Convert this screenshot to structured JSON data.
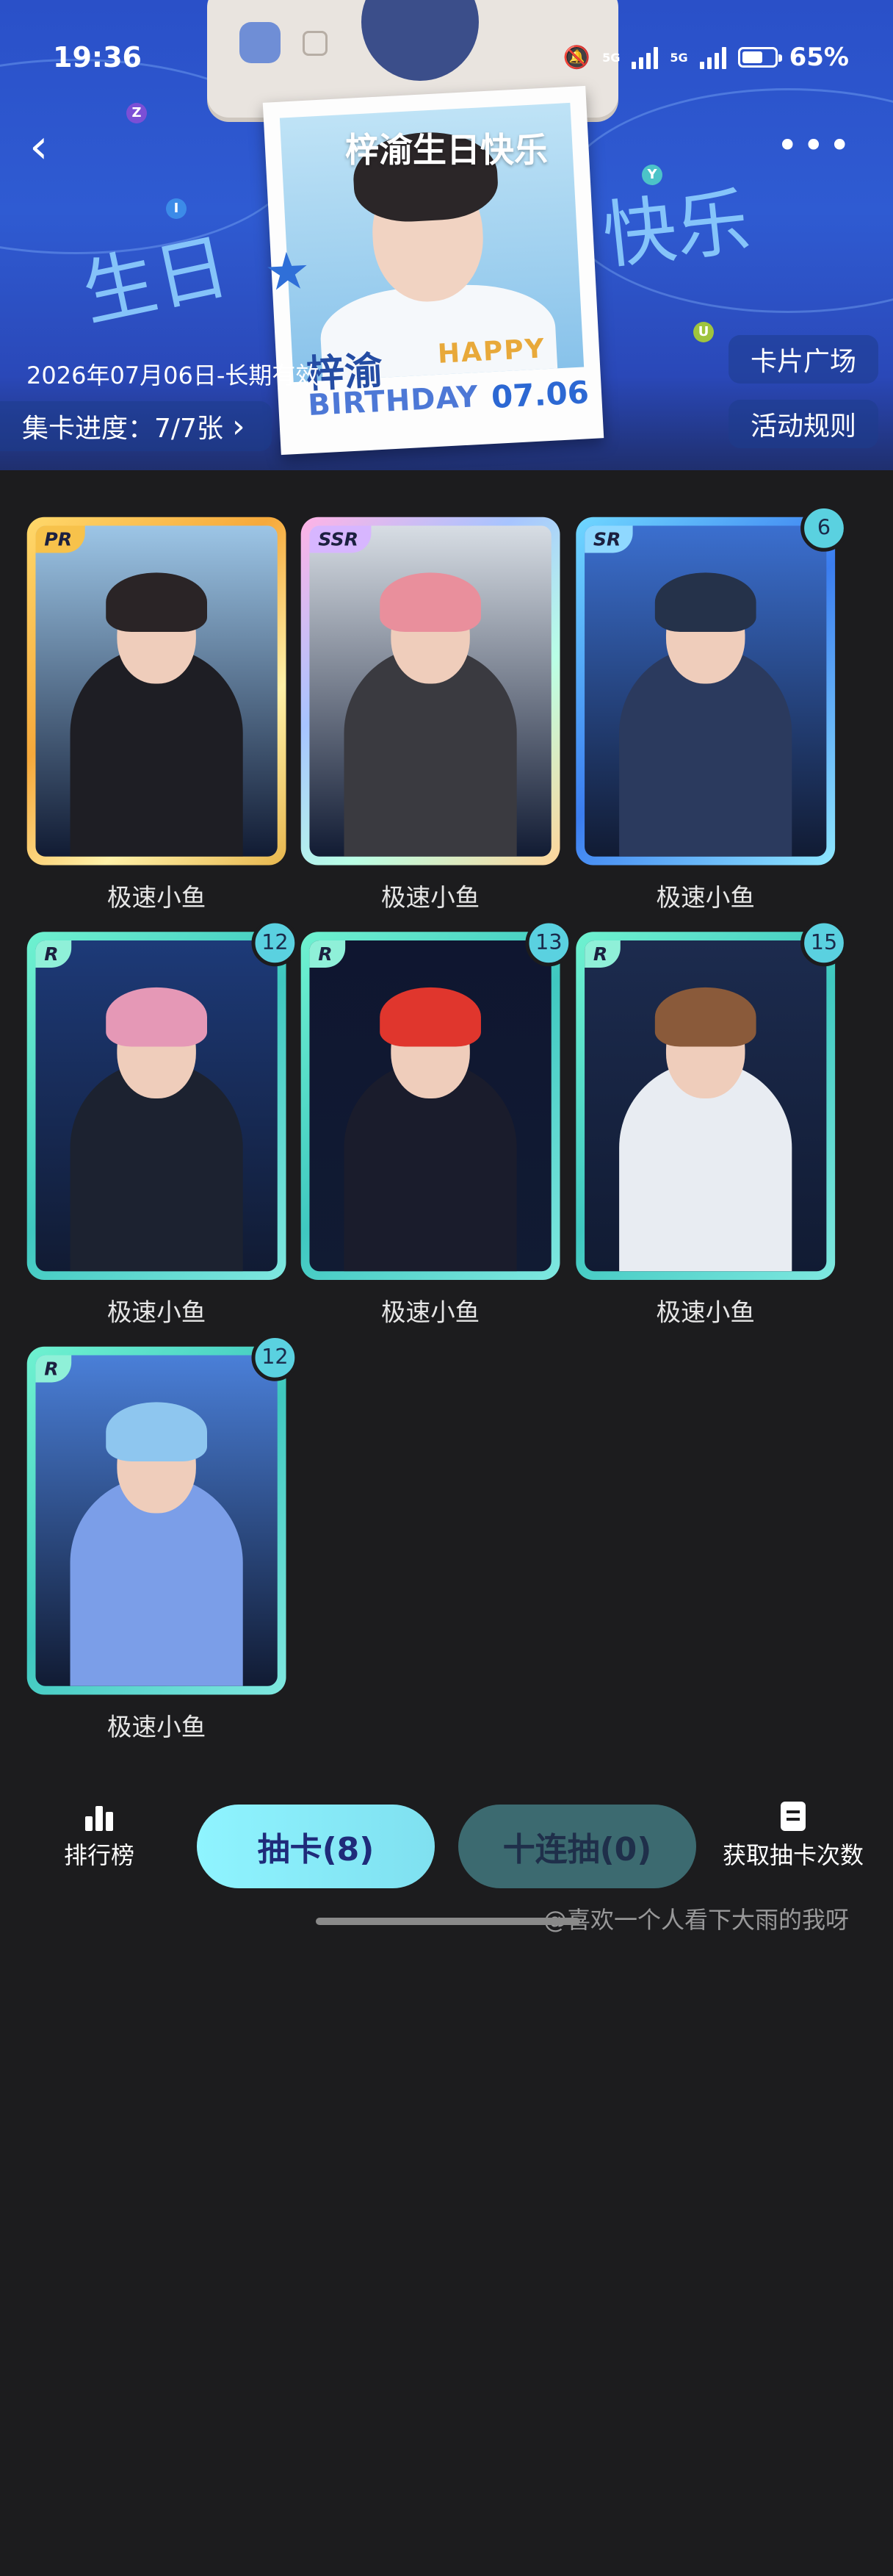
{
  "status_bar": {
    "time": "19:36",
    "net1": "5G",
    "net2": "5G",
    "battery_percent": "65%",
    "battery_level": 0.65
  },
  "header": {
    "title": "梓渝生日快乐",
    "back_icon": "chevron-left-icon",
    "more_icon": "more-horizontal-icon"
  },
  "banner": {
    "name": "梓渝",
    "happy": "HAPPY",
    "birthday": "BIRTHDAY",
    "date": "07.06",
    "handwriting_left": "生日",
    "handwriting_right": "快乐",
    "letters": [
      "Z",
      "I",
      "Y",
      "U"
    ]
  },
  "event": {
    "validity": "2026年07月06日-长期有效",
    "progress_label": "集卡进度：7/7张",
    "progress_chevron": "›",
    "square_button": "卡片广场",
    "rules_button": "活动规则"
  },
  "cards": [
    {
      "rarity": "PR",
      "count": "",
      "caption": "极速小鱼",
      "hair": "#2a2426",
      "outfit": "#1e1e24",
      "bg": "#9cc5e6",
      "frame": "gold"
    },
    {
      "rarity": "SSR",
      "count": "",
      "caption": "极速小鱼",
      "hair": "#e98f9c",
      "outfit": "#3a3a40",
      "bg": "#d7dde4",
      "frame": "rainbow"
    },
    {
      "rarity": "SR",
      "count": "6",
      "caption": "极速小鱼",
      "hair": "#25324a",
      "outfit": "#2b3a5e",
      "bg": "#3b6fcf",
      "frame": "blue"
    },
    {
      "rarity": "R",
      "count": "12",
      "caption": "极速小鱼",
      "hair": "#e598b6",
      "outfit": "#1c2230",
      "bg": "#1d3a78",
      "frame": "teal"
    },
    {
      "rarity": "R",
      "count": "13",
      "caption": "极速小鱼",
      "hair": "#e0362d",
      "outfit": "#1a1c2c",
      "bg": "#0f1630",
      "frame": "teal"
    },
    {
      "rarity": "R",
      "count": "15",
      "caption": "极速小鱼",
      "hair": "#8a5a3a",
      "outfit": "#e8ecf2",
      "bg": "#1c2b4e",
      "frame": "teal"
    },
    {
      "rarity": "R",
      "count": "12",
      "caption": "极速小鱼",
      "hair": "#8ec6ef",
      "outfit": "#7b9ee8",
      "bg": "#4a7fd8",
      "frame": "teal"
    }
  ],
  "bottom_bar": {
    "rank_label": "排行榜",
    "rank_icon": "bar-chart-icon",
    "draw_one": "抽卡(8)",
    "draw_ten": "十连抽(0)",
    "get_draws": "获取抽卡次数",
    "get_draws_icon": "document-icon"
  },
  "watermark": "@喜欢一个人看下大雨的我呀",
  "colors": {
    "hero_blue": "#2f5bd2",
    "page_bg": "#1c1c1e",
    "draw_button": "#8ff4ff",
    "draw_ten_button": "#3c6a70"
  }
}
